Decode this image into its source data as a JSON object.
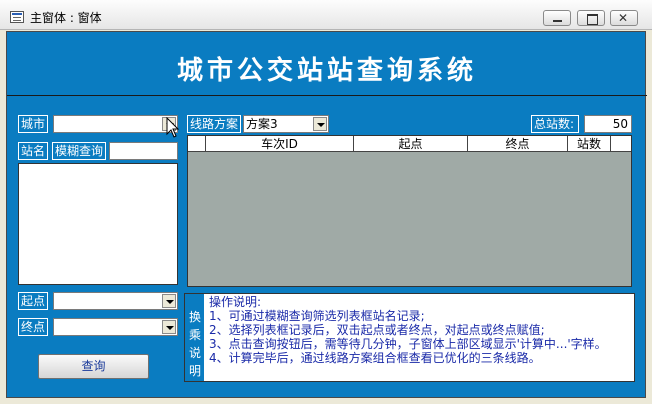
{
  "window": {
    "title": "主窗体 : 窗体"
  },
  "header": {
    "title": "城市公交站站查询系统"
  },
  "city": {
    "label": "城市",
    "value": ""
  },
  "station": {
    "label": "站名",
    "fuzzy_label": "模糊查询",
    "search_value": ""
  },
  "start": {
    "label": "起点",
    "value": ""
  },
  "end": {
    "label": "终点",
    "value": ""
  },
  "query_button": {
    "label": "查询"
  },
  "route_plan": {
    "label": "线路方案",
    "value": "方案3"
  },
  "total_stations": {
    "label": "总站数:",
    "value": "50"
  },
  "grid": {
    "columns": [
      "车次ID",
      "起点",
      "终点",
      "站数"
    ]
  },
  "notes": {
    "side_label": [
      "换",
      "乘",
      "说",
      "明"
    ],
    "lines": [
      "操作说明:",
      "1、可通过模糊查询筛选列表框站名记录;",
      "2、选择列表框记录后，双击起点或者终点，对起点或终点赋值;",
      "3、点击查询按钮后，需等待几分钟，子窗体上部区域显示'计算中...'字样。",
      "4、计算完毕后，通过线路方案组合框查看已优化的三条线路。"
    ]
  },
  "colors": {
    "form_bg": "#0a7cc1",
    "grid_bg": "#a0aaa6",
    "note_text": "#1a2aa8"
  }
}
